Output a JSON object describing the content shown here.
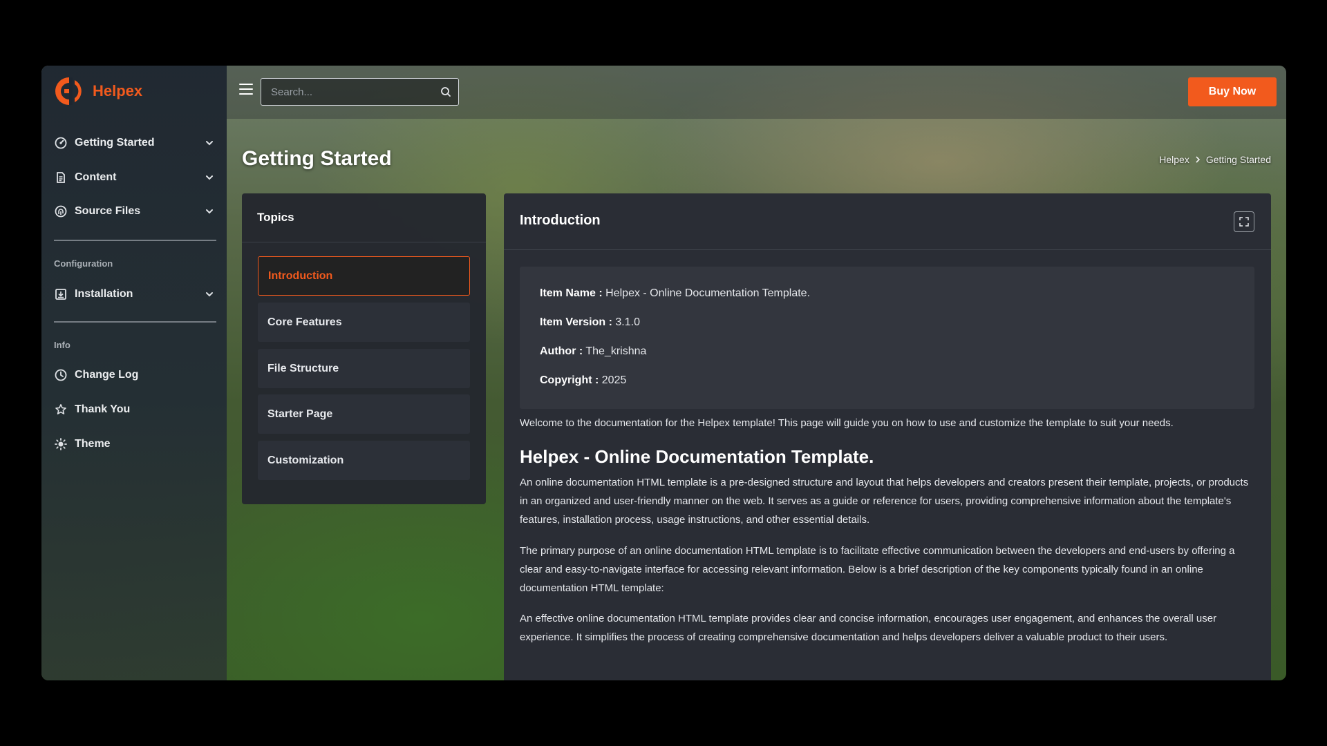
{
  "brand": {
    "name": "Helpex",
    "accent": "#f25a1d"
  },
  "sidebar": {
    "items": [
      {
        "label": "Getting Started",
        "icon": "speedometer-icon"
      },
      {
        "label": "Content",
        "icon": "document-icon"
      },
      {
        "label": "Source Files",
        "icon": "fingerprint-icon"
      }
    ],
    "configuration": {
      "label": "Configuration",
      "items": [
        {
          "label": "Installation",
          "icon": "install-icon"
        }
      ]
    },
    "info": {
      "label": "Info",
      "items": [
        {
          "label": "Change Log",
          "icon": "clock-icon"
        },
        {
          "label": "Thank You",
          "icon": "star-icon"
        },
        {
          "label": "Theme",
          "icon": "sun-icon"
        }
      ]
    }
  },
  "topbar": {
    "search_placeholder": "Search...",
    "buy_label": "Buy Now"
  },
  "page": {
    "title": "Getting Started",
    "breadcrumb": [
      "Helpex",
      "Getting Started"
    ]
  },
  "topics": {
    "title": "Topics",
    "items": [
      "Introduction",
      "Core Features",
      "File Structure",
      "Starter Page",
      "Customization"
    ],
    "active": "Introduction"
  },
  "content": {
    "title": "Introduction",
    "info": [
      {
        "key": "Item Name :",
        "value": "Helpex - Online Documentation Template."
      },
      {
        "key": "Item Version :",
        "value": "3.1.0"
      },
      {
        "key": "Author :",
        "value": "The_krishna"
      },
      {
        "key": "Copyright :",
        "value": "2025"
      }
    ],
    "welcome": "Welcome to the documentation for the Helpex template! This page will guide you on how to use and customize the template to suit your needs.",
    "heading": "Helpex - Online Documentation Template.",
    "paragraphs": [
      "An online documentation HTML template is a pre-designed structure and layout that helps developers and creators present their template, projects, or products in an organized and user-friendly manner on the web. It serves as a guide or reference for users, providing comprehensive information about the template's features, installation process, usage instructions, and other essential details.",
      "The primary purpose of an online documentation HTML template is to facilitate effective communication between the developers and end-users by offering a clear and easy-to-navigate interface for accessing relevant information. Below is a brief description of the key components typically found in an online documentation HTML template:",
      "An effective online documentation HTML template provides clear and concise information, encourages user engagement, and enhances the overall user experience. It simplifies the process of creating comprehensive documentation and helps developers deliver a valuable product to their users."
    ]
  }
}
